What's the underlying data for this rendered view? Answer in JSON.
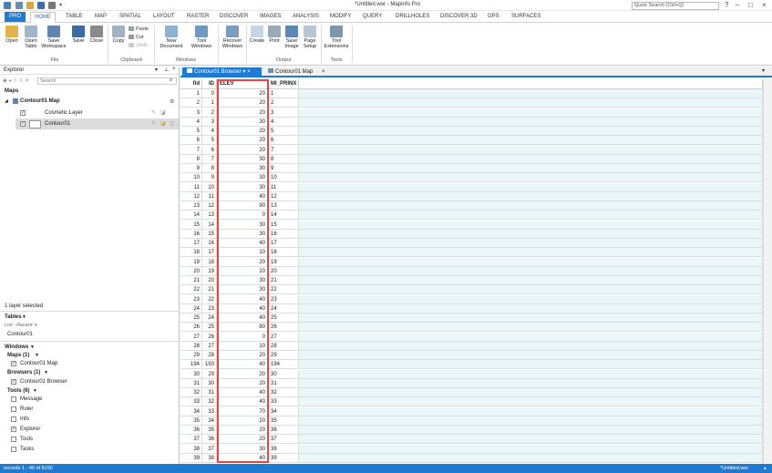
{
  "titlebar": {
    "title": "*Untitled.wor - MapInfo Pro",
    "search_placeholder": "Quick Search (Ctrl+Q)"
  },
  "tabs": [
    "PRO",
    "HOME",
    "TABLE",
    "MAP",
    "SPATIAL",
    "LAYOUT",
    "RASTER",
    "DISCOVER",
    "IMAGES",
    "ANALYSIS",
    "MODIFY",
    "QUERY",
    "DRILLHOLES",
    "DISCOVER 3D",
    "GPS",
    "SURFACES"
  ],
  "ribbon": {
    "open": "Open",
    "open_table": "Open Table",
    "save_workspace": "Save Workspace",
    "save": "Save",
    "close": "Close",
    "copy": "Copy",
    "paste": "Paste",
    "cut": "Cut",
    "undo": "Undo",
    "new_document": "New Document",
    "tool_windows": "Tool Windows",
    "recover_windows": "Recover Windows",
    "create": "Create",
    "print": "Print",
    "save_image": "Save Image",
    "page_setup": "Page Setup",
    "tool_extensions": "Tool Extensions",
    "group_file": "File",
    "group_clipboard": "Clipboard",
    "group_windows": "Windows",
    "group_output": "Output",
    "group_tools": "Tools"
  },
  "explorer": {
    "title": "Explorer",
    "search_placeholder": "Search",
    "maps_header": "Maps",
    "map_name": "Contour01 Map",
    "cosmetic_layer": "Cosmetic Layer",
    "layer_name": "Contour01",
    "selected_info": "1 layer selected",
    "tables_header": "Tables",
    "list_recent": "List : Recent",
    "table_name": "Contour01",
    "windows_header": "Windows",
    "maps_count": "Maps  (1)",
    "map_window": "Contour01 Map",
    "browsers_count": "Browsers  (1)",
    "browser_window": "Contour01 Browser",
    "tools_count": "Tools  (6)",
    "tools": [
      {
        "name": "Message",
        "checked": false
      },
      {
        "name": "Ruler",
        "checked": false
      },
      {
        "name": "Info",
        "checked": false
      },
      {
        "name": "Explorer",
        "checked": true
      },
      {
        "name": "Tools",
        "checked": false
      },
      {
        "name": "Tasks",
        "checked": false
      }
    ]
  },
  "doc_tabs": {
    "browser": "Contour01 Browser",
    "map": "Contour01 Map"
  },
  "grid": {
    "columns": [
      "fid",
      "ID",
      "ELEV",
      "MI_PRINX"
    ],
    "rows": [
      [
        1,
        0,
        20,
        1
      ],
      [
        2,
        1,
        20,
        2
      ],
      [
        3,
        2,
        20,
        3
      ],
      [
        4,
        3,
        30,
        4
      ],
      [
        5,
        4,
        20,
        5
      ],
      [
        6,
        5,
        20,
        6
      ],
      [
        7,
        6,
        20,
        7
      ],
      [
        8,
        7,
        30,
        8
      ],
      [
        9,
        8,
        30,
        9
      ],
      [
        10,
        9,
        30,
        10
      ],
      [
        11,
        10,
        30,
        11
      ],
      [
        12,
        11,
        40,
        12
      ],
      [
        13,
        12,
        90,
        13
      ],
      [
        14,
        13,
        0,
        14
      ],
      [
        15,
        14,
        30,
        15
      ],
      [
        16,
        15,
        30,
        16
      ],
      [
        17,
        16,
        40,
        17
      ],
      [
        18,
        17,
        10,
        18
      ],
      [
        19,
        18,
        20,
        19
      ],
      [
        20,
        19,
        20,
        20
      ],
      [
        21,
        20,
        30,
        21
      ],
      [
        22,
        21,
        30,
        22
      ],
      [
        23,
        22,
        40,
        23
      ],
      [
        24,
        23,
        40,
        24
      ],
      [
        25,
        24,
        40,
        25
      ],
      [
        26,
        25,
        80,
        26
      ],
      [
        27,
        26,
        0,
        27
      ],
      [
        28,
        27,
        10,
        28
      ],
      [
        29,
        28,
        20,
        29
      ],
      [
        194,
        193,
        40,
        194
      ],
      [
        30,
        29,
        20,
        30
      ],
      [
        31,
        30,
        20,
        31
      ],
      [
        32,
        31,
        40,
        32
      ],
      [
        33,
        32,
        40,
        33
      ],
      [
        34,
        33,
        70,
        34
      ],
      [
        35,
        34,
        20,
        35
      ],
      [
        36,
        35,
        20,
        36
      ],
      [
        37,
        36,
        20,
        37
      ],
      [
        38,
        37,
        30,
        38
      ],
      [
        39,
        38,
        40,
        39
      ]
    ]
  },
  "status": {
    "records": "records 1 - 40 of 8150",
    "file": "*Untitled.wor"
  },
  "colors": {
    "accent": "#1f7bd1",
    "highlight_border": "#e04848",
    "grid_fill": "#eaf6f8"
  }
}
